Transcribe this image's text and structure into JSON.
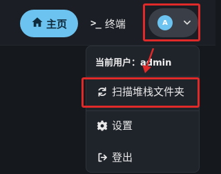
{
  "topbar": {
    "home_label": "主页",
    "terminal_label": "终端",
    "avatar_letter": "A"
  },
  "user_menu": {
    "current_user_prefix": "当前用户：",
    "current_user_name": "admin",
    "items": [
      {
        "label": "扫描堆栈文件夹",
        "icon": "refresh-icon"
      },
      {
        "label": "设置",
        "icon": "gear-icon"
      },
      {
        "label": "登出",
        "icon": "logout-icon"
      }
    ]
  },
  "colors": {
    "accent": "#6cc3f0",
    "highlight": "#e02a2a",
    "background": "#15181d",
    "menu_background": "#1f232a"
  }
}
